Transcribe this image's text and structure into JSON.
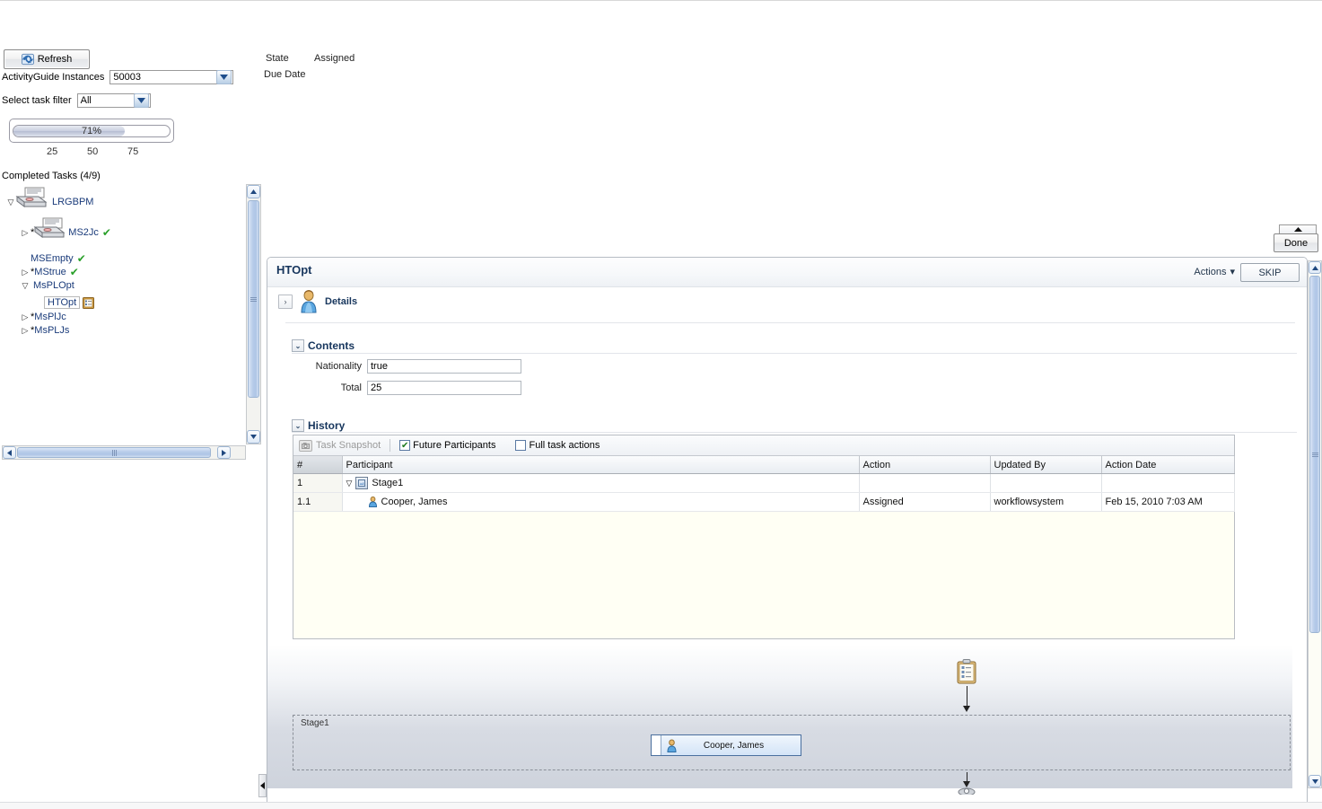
{
  "toolbar": {
    "refresh_label": "Refresh",
    "refresh_icon": "refresh-icon",
    "instances_label": "ActivityGuide Instances",
    "instances_value": "50003",
    "filter_label": "Select task filter",
    "filter_value": "All"
  },
  "progress": {
    "percent_label": "71%",
    "percent_value": 71,
    "ticks": [
      "25",
      "50",
      "75"
    ],
    "completed_label": "Completed Tasks  (4/9)"
  },
  "status": {
    "state_label": "State",
    "state_value": "Assigned",
    "due_date_label": "Due Date",
    "due_date_value": ""
  },
  "tree": {
    "nodes": [
      {
        "label": "LRGBPM",
        "twisty": "▽",
        "icon": "process-icon",
        "star": false,
        "check": false
      },
      {
        "label": "MS2Jc",
        "twisty": "▷",
        "icon": "process-icon",
        "star": true,
        "check": true
      },
      {
        "label": "MSEmpty",
        "twisty": "",
        "icon": "",
        "star": false,
        "check": true
      },
      {
        "label": "MStrue",
        "twisty": "▷",
        "icon": "",
        "star": true,
        "check": true
      },
      {
        "label": "MsPLOpt",
        "twisty": "▽",
        "icon": "",
        "star": false,
        "check": false
      },
      {
        "label": "HTOpt",
        "twisty": "",
        "icon": "task-icon",
        "star": false,
        "check": false
      },
      {
        "label": "MsPlJc",
        "twisty": "▷",
        "icon": "",
        "star": true,
        "check": false
      },
      {
        "label": "MsPLJs",
        "twisty": "▷",
        "icon": "",
        "star": true,
        "check": false
      }
    ]
  },
  "done_button": {
    "label": "Done"
  },
  "task_panel": {
    "title": "HTOpt",
    "actions_label": "Actions",
    "actions_caret": "▾",
    "skip_label": "SKIP",
    "details_label": "Details",
    "details_expander": "›",
    "contents": {
      "header": "Contents",
      "toggle": "⌄",
      "fields": [
        {
          "label": "Nationality",
          "value": "true"
        },
        {
          "label": "Total",
          "value": "25"
        }
      ]
    },
    "history": {
      "header": "History",
      "toggle": "⌄",
      "task_snapshot_label": "Task Snapshot",
      "future_participants_label": "Future Participants",
      "future_participants_checked": true,
      "full_task_actions_label": "Full task actions",
      "full_task_actions_checked": false,
      "columns": [
        "#",
        "Participant",
        "Action",
        "Updated By",
        "Action Date"
      ],
      "rows": [
        {
          "num": "1",
          "participant": "Stage1",
          "participant_icon": "stage-icon",
          "twisty": "▽",
          "indent": 0,
          "action": "",
          "updated_by": "",
          "action_date": ""
        },
        {
          "num": "1.1",
          "participant": "Cooper, James",
          "participant_icon": "user-icon",
          "twisty": "",
          "indent": 1,
          "action": "Assigned",
          "updated_by": "workflowsystem",
          "action_date": "Feb 15, 2010 7:03 AM"
        }
      ]
    },
    "flow": {
      "start_icon": "clipboard-icon",
      "stage_label": "Stage1",
      "actor_label": "Cooper, James",
      "actor_icon": "user-icon"
    }
  },
  "colors": {
    "accent": "#17365d",
    "tree_link": "#1a3b7a",
    "check_green": "#2aa02a",
    "panel_border": "#b6bcc4",
    "scroll_thumb": "#aec5e6"
  }
}
